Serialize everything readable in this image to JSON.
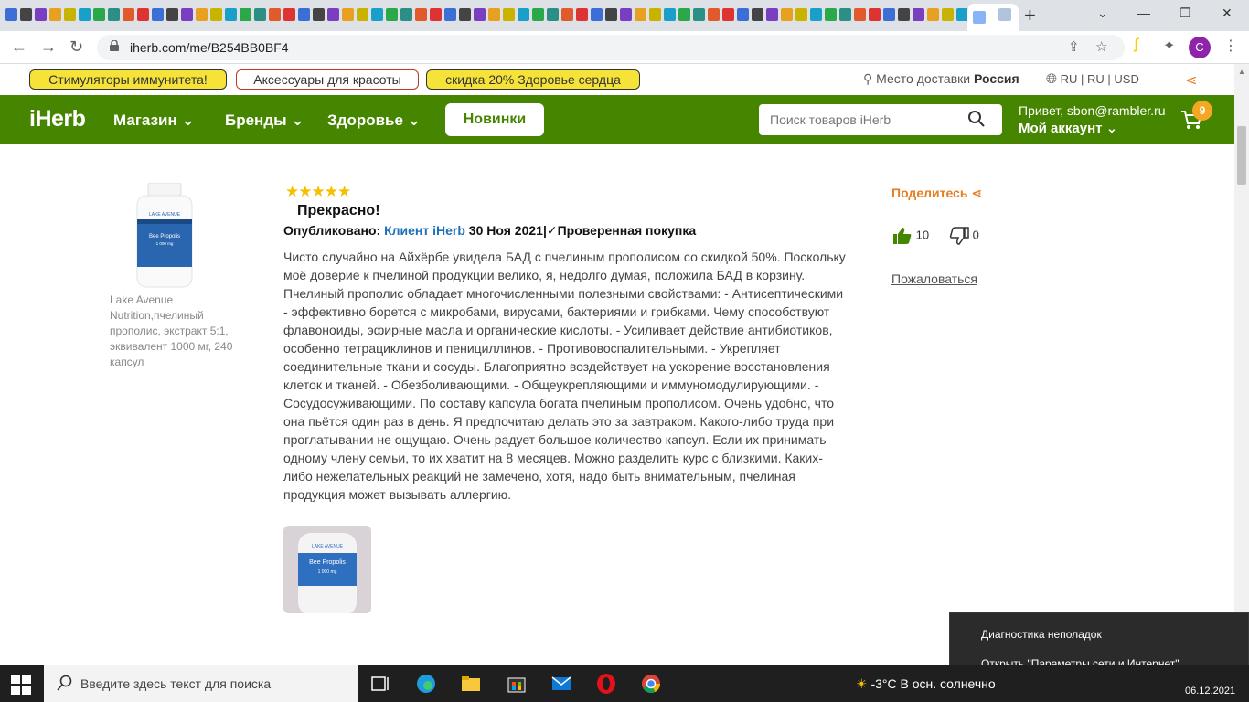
{
  "browser": {
    "url": "iherb.com/me/B254BB0BF4",
    "profile_initial": "C"
  },
  "promo": {
    "pill1": "Стимуляторы иммунитета!",
    "pill2": "Аксессуары для красоты",
    "pill3": "скидка 20% Здоровье сердца",
    "delivery_label": "Место доставки",
    "delivery_country": "Россия",
    "lang": "RU | RU | USD"
  },
  "nav": {
    "logo": "iHerb",
    "shop": "Магазин",
    "brands": "Бренды",
    "health": "Здоровье",
    "new": "Новинки",
    "search_placeholder": "Поиск товаров iHerb",
    "greeting": "Привет, sbon@rambler.ru",
    "account": "Мой аккаунт",
    "cart_count": "9"
  },
  "product": {
    "name": "Lake Avenue Nutrition,пчелиный прополис, экстракт 5:1, эквивалент 1000 мг, 240 капсул",
    "label_brand": "LAKE AVENUE",
    "label_name": "Bee Propolis",
    "label_dose": "1 000 mg"
  },
  "review": {
    "rating": 5,
    "stars": "★★★★★",
    "title": "Прекрасно!",
    "published_label": "Опубликовано:",
    "author": "Клиент iHerb",
    "date": "30 Ноя 2021|",
    "verified": "✓Проверенная покупка",
    "body": "Чисто случайно на Айхёрбе увидела БАД с пчелиным прополисом со скидкой 50%. Поскольку моё доверие к пчелиной продукции велико, я, недолго думая, положила БАД в корзину. Пчелиный прополис обладает многочисленными полезными свойствами: - Антисептическими - эффективно борется с микробами, вирусами, бактериями и грибками. Чему способствуют флавоноиды, эфирные масла и органические кислоты. - Усиливает действие антибиотиков, особенно тетрациклинов и пенициллинов. - Противовоспалительными. - Укрепляет соединительные ткани и сосуды. Благоприятно воздействует на ускорение восстановления клеток и тканей. - Обезболивающими. - Общеукрепляющими и иммуномодулирующими. - Сосудосуживающими. По составу капсула богата пчелиным прополисом. Очень удобно, что она пьётся один раз в день. Я предпочитаю делать это за завтраком. Какого-либо труда при проглатывании не ощущаю. Очень радует большое количество капсул. Если их принимать одному члену семьи, то их хватит на 8 месяцев. Можно разделить курс с близкими. Каких-либо нежелательных реакций не замечено, хотя, надо быть внимательным, пчелиная продукция может вызывать аллергию.",
    "share": "Поделитесь",
    "likes": "10",
    "dislikes": "0",
    "report": "Пожаловаться"
  },
  "popup": {
    "item1": "Диагностика неполадок",
    "item2": "Открыть \"Параметры сети и Интернет\""
  },
  "taskbar": {
    "search_placeholder": "Введите здесь текст для поиска",
    "weather": "-3°C  В осн. солнечно",
    "date": "06.12.2021"
  },
  "colors": {
    "brand_green": "#458500",
    "accent_orange": "#e67e22",
    "promo_yellow": "#f6e33a",
    "link_blue": "#1e6fb7",
    "star_gold": "#f5c000"
  }
}
